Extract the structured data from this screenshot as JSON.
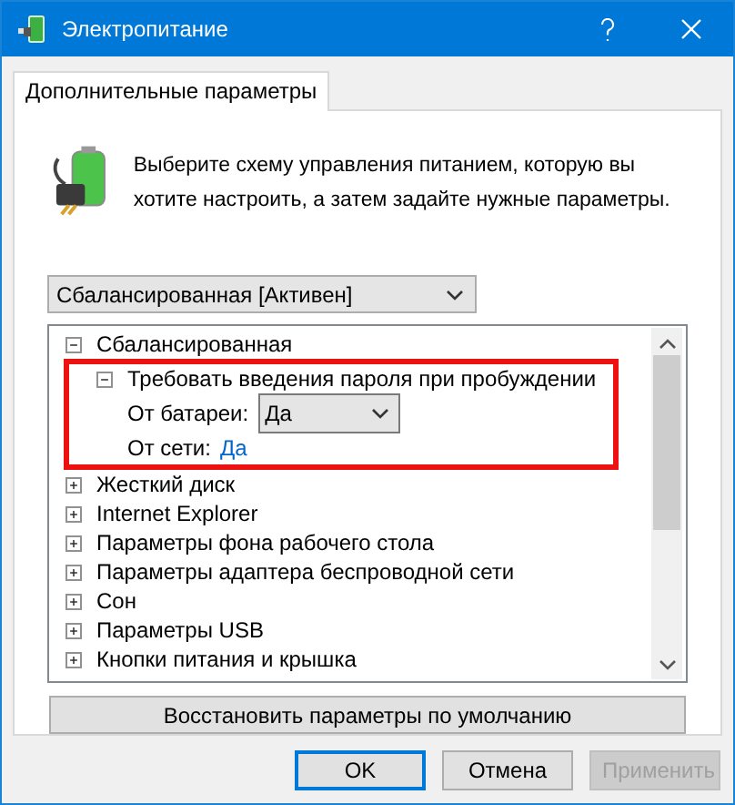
{
  "window": {
    "title": "Электропитание"
  },
  "tabs": [
    {
      "label": "Дополнительные параметры",
      "selected": true
    }
  ],
  "intro": "Выберите схему управления питанием, которую вы хотите настроить, а затем задайте нужные параметры.",
  "plan_dropdown": {
    "value": "Сбалансированная [Активен]"
  },
  "tree": [
    {
      "label": "Сбалансированная",
      "expanded": true,
      "children": [
        {
          "label": "Требовать введения пароля при пробуждении",
          "expanded": true,
          "highlighted": true,
          "settings": [
            {
              "kind": "select",
              "label": "От батареи:",
              "value": "Да"
            },
            {
              "kind": "link",
              "label": "От сети:",
              "value": "Да"
            }
          ]
        }
      ]
    },
    {
      "label": "Жесткий диск",
      "expanded": false
    },
    {
      "label": "Internet Explorer",
      "expanded": false
    },
    {
      "label": "Параметры фона рабочего стола",
      "expanded": false
    },
    {
      "label": "Параметры адаптера беспроводной сети",
      "expanded": false
    },
    {
      "label": "Сон",
      "expanded": false
    },
    {
      "label": "Параметры USB",
      "expanded": false
    },
    {
      "label": "Кнопки питания и крышка",
      "expanded": false
    }
  ],
  "restore_button": "Восстановить параметры по умолчанию",
  "buttons": [
    {
      "label": "OK",
      "default": true,
      "disabled": false
    },
    {
      "label": "Отмена",
      "default": false,
      "disabled": false
    },
    {
      "label": "Применить",
      "default": false,
      "disabled": true
    }
  ]
}
